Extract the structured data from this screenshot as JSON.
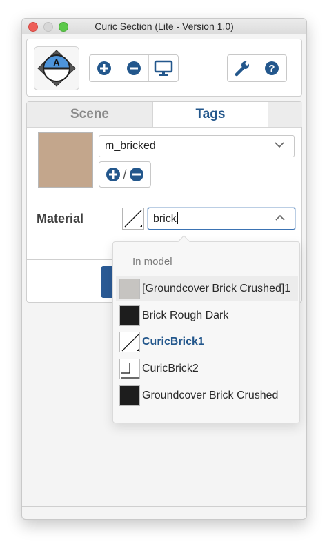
{
  "window": {
    "title": "Curic Section (Lite - Version 1.0)"
  },
  "toolbar": {
    "logo_letter": "A",
    "buttons": [
      "add-icon",
      "remove-icon",
      "monitor-icon",
      "wrench-icon",
      "help-icon"
    ]
  },
  "tabs": [
    {
      "label": "Scene",
      "active": false
    },
    {
      "label": "Tags",
      "active": true
    }
  ],
  "tag": {
    "swatch_color": "#c3a68c",
    "selected_value": "m_bricked",
    "add_remove_separator": "/"
  },
  "material": {
    "label": "Material",
    "search_value": "brick",
    "dropdown": {
      "group_header": "In model",
      "items": [
        {
          "label": "[Groundcover Brick Crushed]1",
          "thumb": "gray-swatch",
          "thumb_color": "#c6c4c1"
        },
        {
          "label": "Brick Rough Dark",
          "thumb": "dark-swatch",
          "thumb_color": "#1d1d1d"
        },
        {
          "label": "CuricBrick1",
          "thumb": "diagonal-line-icon",
          "selected": true
        },
        {
          "label": "CuricBrick2",
          "thumb": "step-line-icon"
        },
        {
          "label": "Groundcover Brick Crushed",
          "thumb": "dark-swatch",
          "thumb_color": "#1d1d1d"
        }
      ]
    }
  },
  "colors": {
    "accent": "#23578c",
    "accent_button": "#1f5ea7"
  }
}
